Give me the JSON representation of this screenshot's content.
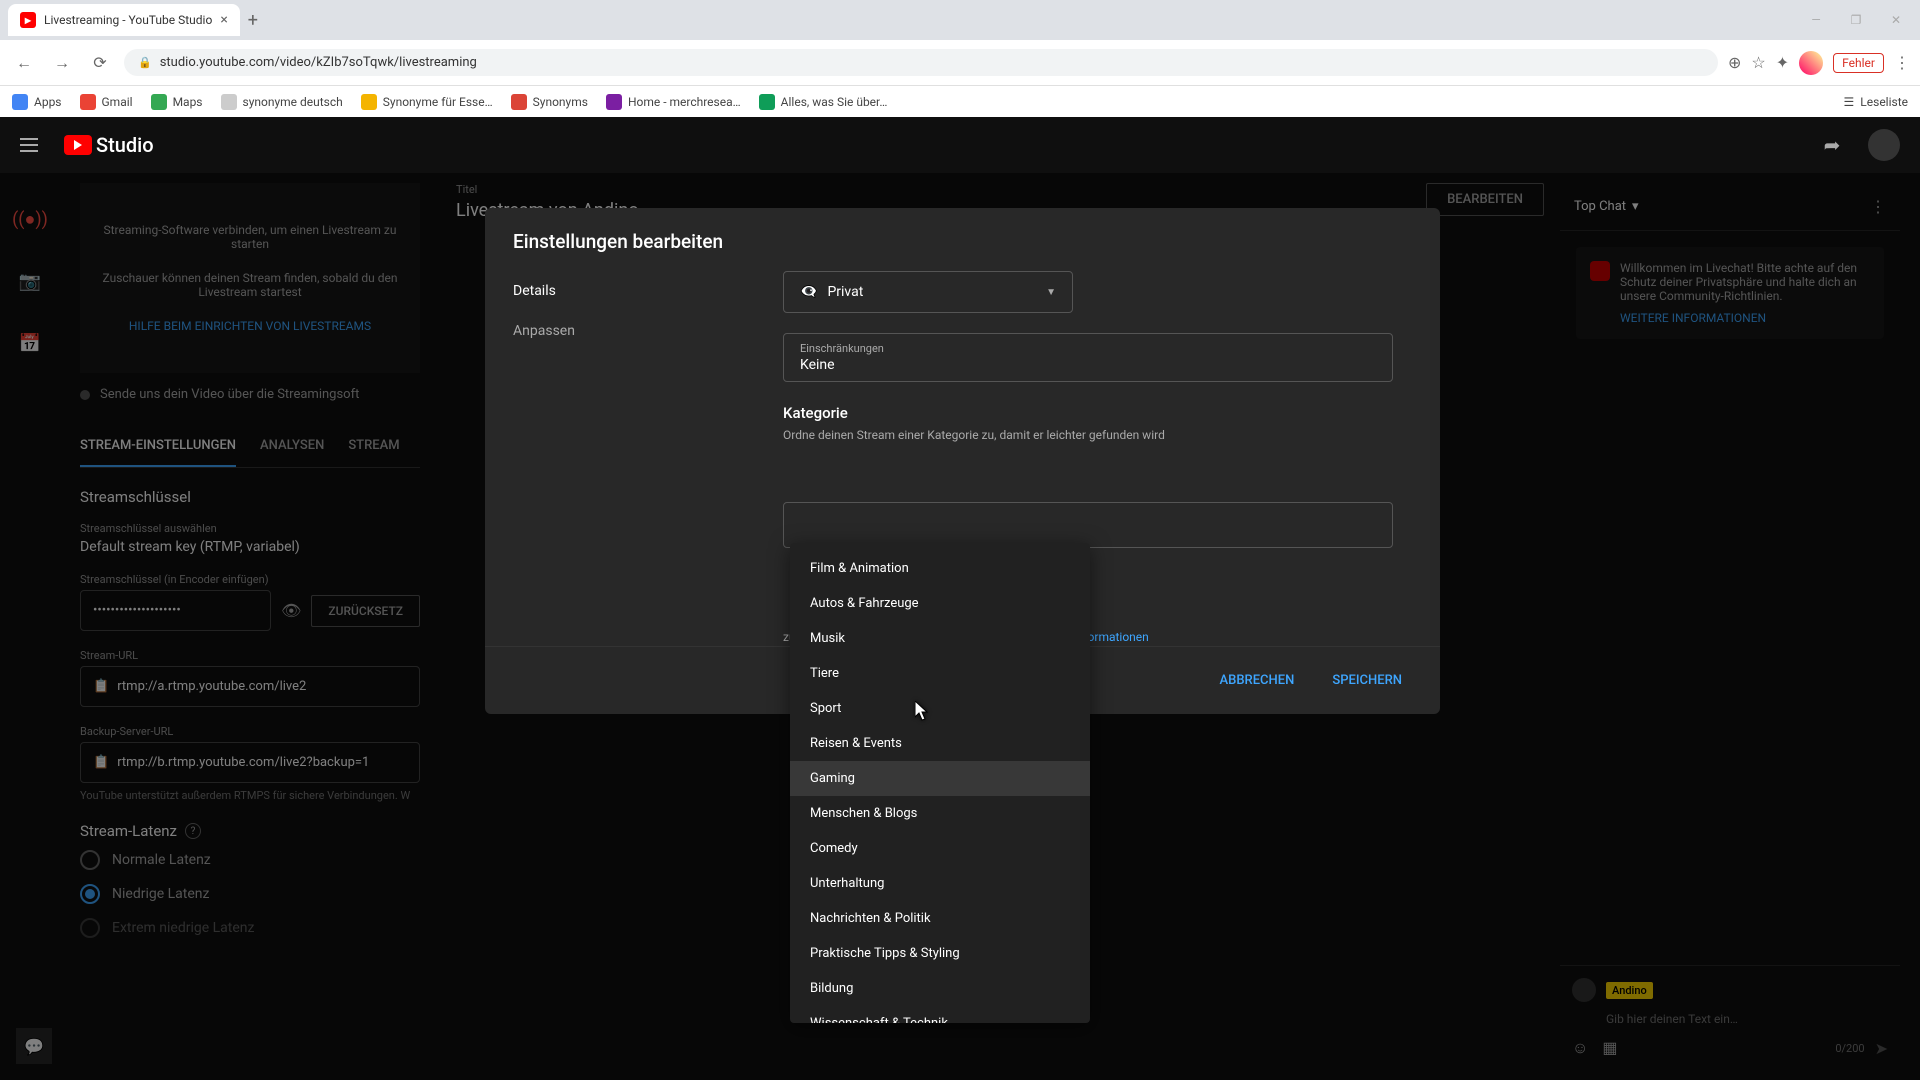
{
  "browser": {
    "tab_title": "Livestreaming - YouTube Studio",
    "url": "studio.youtube.com/video/kZIb7soTqwk/livestreaming",
    "error_badge": "Fehler",
    "readlist": "Leseliste",
    "bookmarks": [
      "Apps",
      "Gmail",
      "Maps",
      "synonyme deutsch",
      "Synonyme für Esse…",
      "Synonyms",
      "Home - merchresea…",
      "Alles, was Sie über…"
    ]
  },
  "header": {
    "logo_text": "Studio"
  },
  "left_nav": {
    "items": [
      "stream",
      "camera",
      "calendar"
    ]
  },
  "preview": {
    "connect_text": "Streaming-Software verbinden, um einen Livestream zu starten",
    "viewer_text": "Zuschauer können deinen Stream finden, sobald du den Livestream startest",
    "help_link": "HILFE BEIM EINRICHTEN VON LIVESTREAMS",
    "status": "Sende uns dein Video über die Streamingsoft"
  },
  "tabs": [
    "STREAM-EINSTELLUNGEN",
    "ANALYSEN",
    "STREAM"
  ],
  "stream_key": {
    "title": "Streamschlüssel",
    "select_label": "Streamschlüssel auswählen",
    "select_value": "Default stream key (RTMP, variabel)",
    "key_label": "Streamschlüssel (in Encoder einfügen)",
    "key_value": "••••••••••••••••••••",
    "reset_btn": "ZURÜCKSETZ",
    "url_label": "Stream-URL",
    "url_value": "rtmp://a.rtmp.youtube.com/live2",
    "backup_label": "Backup-Server-URL",
    "backup_value": "rtmp://b.rtmp.youtube.com/live2?backup=1",
    "helper": "YouTube unterstützt außerdem RTMPS für sichere Verbindungen. W"
  },
  "latency": {
    "title": "Stream-Latenz",
    "options": [
      "Normale Latenz",
      "Niedrige Latenz",
      "Extrem niedrige Latenz"
    ],
    "selected": 1
  },
  "title_card": {
    "label": "Titel",
    "value": "Livestream von Andino",
    "edit": "BEARBEITEN"
  },
  "chat": {
    "tab": "Top Chat",
    "welcome": "Willkommen im Livechat! Bitte achte auf den Schutz deiner Privatsphäre und halte dich an unsere Community-Richtlinien.",
    "welcome_link": "WEITERE INFORMATIONEN",
    "username": "Andino",
    "placeholder": "Gib hier deinen Text ein…",
    "counter": "0/200"
  },
  "modal": {
    "title": "Einstellungen bearbeiten",
    "sidebar": [
      "Details",
      "Anpassen"
    ],
    "privacy": "Privat",
    "restrictions_label": "Einschränkungen",
    "restrictions_value": "Keine",
    "category_title": "Kategorie",
    "category_desc": "Ordne deinen Stream einer Kategorie zu, damit er leichter gefunden wird",
    "thumb_text_1": "zu deinem Stream passt. Ein gutes Thumbnail fällt auf",
    "thumb_link": "Informationen",
    "cancel": "ABBRECHEN",
    "save": "SPEICHERN"
  },
  "categories": [
    "Film & Animation",
    "Autos & Fahrzeuge",
    "Musik",
    "Tiere",
    "Sport",
    "Reisen & Events",
    "Gaming",
    "Menschen & Blogs",
    "Comedy",
    "Unterhaltung",
    "Nachrichten & Politik",
    "Praktische Tipps & Styling",
    "Bildung",
    "Wissenschaft & Technik"
  ]
}
